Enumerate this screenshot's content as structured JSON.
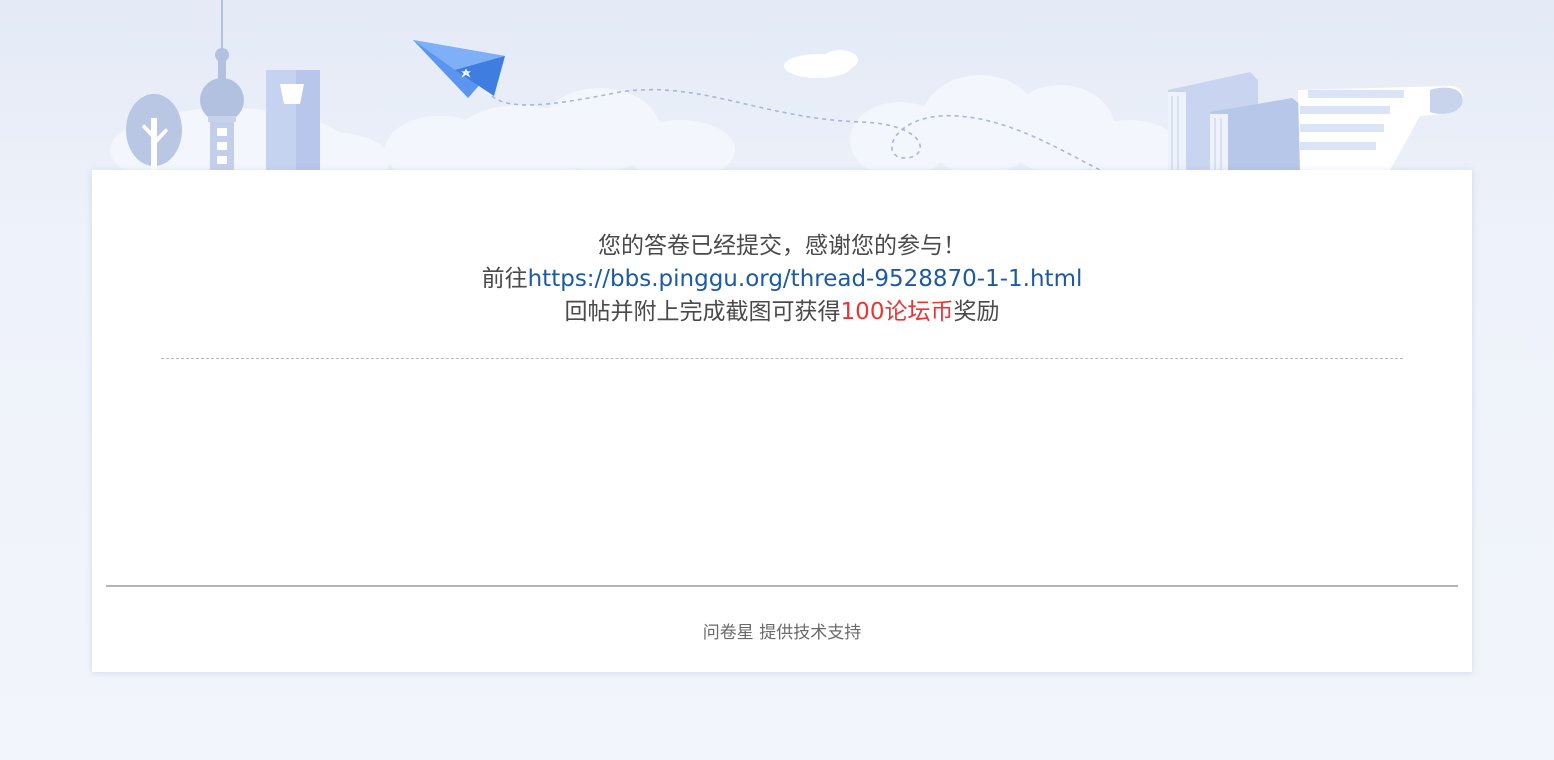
{
  "message": {
    "line1": "您的答卷已经提交，感谢您的参与！",
    "line2_prefix": "前往",
    "link_text": "https://bbs.pinggu.org/thread-9528870-1-1.html",
    "line3_prefix": "回帖并附上完成截图可获得",
    "reward_text": "100论坛币",
    "line3_suffix": "奖励"
  },
  "footer": {
    "credit": "问卷星 提供技术支持"
  },
  "colors": {
    "link": "#1c5aa5",
    "reward": "#ee3333",
    "text": "#4a4a4a",
    "plane": "#4d8ef0"
  }
}
